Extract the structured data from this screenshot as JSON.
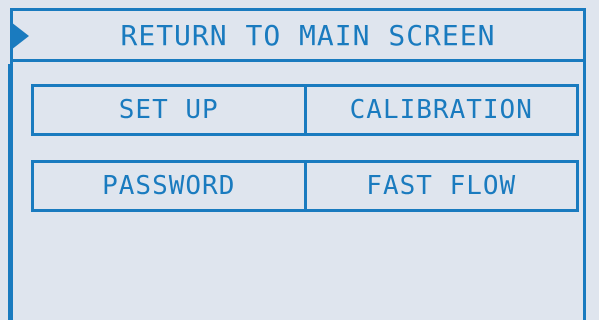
{
  "header": {
    "title": "RETURN TO MAIN SCREEN",
    "selector_icon": "triangle-right-icon"
  },
  "menu": {
    "row1": {
      "left_label": "SET UP",
      "right_label": "CALIBRATION"
    },
    "row2": {
      "left_label": "PASSWORD",
      "right_label": "FAST FLOW"
    }
  },
  "colors": {
    "accent": "#1a7bbf",
    "background": "#dfe5ee"
  }
}
